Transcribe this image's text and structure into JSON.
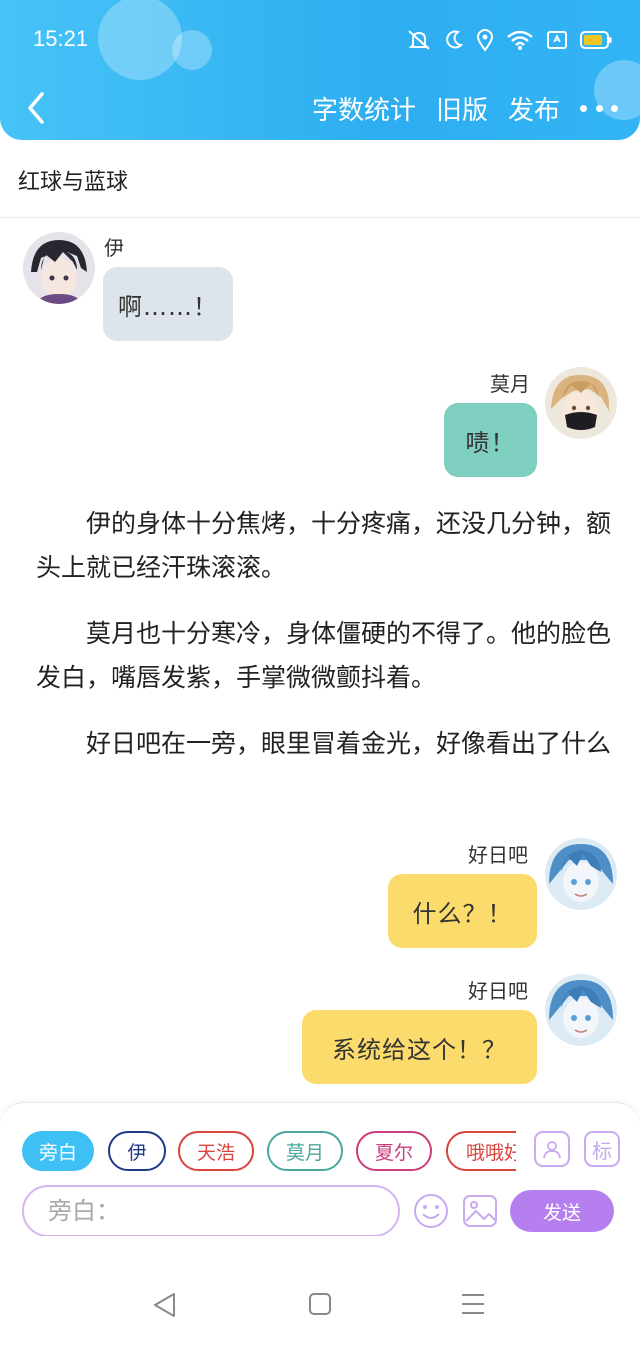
{
  "status_bar": {
    "time": "15:21"
  },
  "nav": {
    "actions": [
      "字数统计",
      "旧版",
      "发布"
    ]
  },
  "document": {
    "title": "红球与蓝球"
  },
  "messages": [
    {
      "speaker": "伊",
      "text": "啊……！",
      "side": "left",
      "color": "#dde4ec"
    },
    {
      "speaker": "莫月",
      "text": "啧！",
      "side": "right",
      "color": "#7fcfc1"
    },
    {
      "speaker": "好日吧",
      "text": "什么？！",
      "side": "right",
      "color": "#fbdb6b"
    },
    {
      "speaker": "好日吧",
      "text": "系统给这个！？",
      "side": "right",
      "color": "#fbdb6b"
    }
  ],
  "narration": [
    "伊的身体十分焦烤，十分疼痛，还没几分钟，额头上就已经汗珠滚滚。",
    "莫月也十分寒冷，身体僵硬的不得了。他的脸色发白，嘴唇发紫，手掌微微颤抖着。",
    "好日吧在一旁，眼里冒着金光，好像看出了什么"
  ],
  "roles": [
    {
      "label": "旁白",
      "selected": true,
      "color": "#3fc0f4"
    },
    {
      "label": "伊",
      "selected": false,
      "color": "#1f3a8a"
    },
    {
      "label": "天浩",
      "selected": false,
      "color": "#d9443c"
    },
    {
      "label": "莫月",
      "selected": false,
      "color": "#4aa7a0"
    },
    {
      "label": "夏尔",
      "selected": false,
      "color": "#cc3d7c"
    },
    {
      "label": "哦哦好",
      "selected": false,
      "color": "#d9443c"
    }
  ],
  "role_icons": {
    "character": "person-card-icon",
    "tag": "标"
  },
  "input": {
    "placeholder": "旁白："
  },
  "send": {
    "label": "发送"
  },
  "colors": {
    "header": "#2eaef0",
    "accent": "#b57ff0"
  }
}
